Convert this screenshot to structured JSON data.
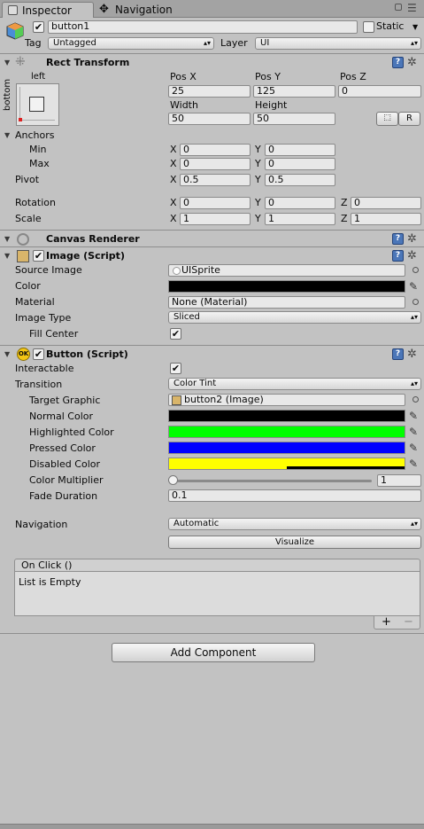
{
  "tabs": {
    "inspector": "Inspector",
    "navigation": "Navigation"
  },
  "object": {
    "name": "button1",
    "static_label": "Static",
    "tag_label": "Tag",
    "tag_value": "Untagged",
    "layer_label": "Layer",
    "layer_value": "UI"
  },
  "rect": {
    "title": "Rect Transform",
    "anchor_top": "left",
    "anchor_side": "bottom",
    "posx_label": "Pos X",
    "posy_label": "Pos Y",
    "posz_label": "Pos Z",
    "posx": "25",
    "posy": "125",
    "posz": "0",
    "width_label": "Width",
    "height_label": "Height",
    "width": "50",
    "height": "50",
    "raw_btn": "R",
    "anchors_label": "Anchors",
    "min_label": "Min",
    "max_label": "Max",
    "min_x": "0",
    "min_y": "0",
    "max_x": "0",
    "max_y": "0",
    "pivot_label": "Pivot",
    "pivot_x": "0.5",
    "pivot_y": "0.5",
    "rotation_label": "Rotation",
    "rot_x": "0",
    "rot_y": "0",
    "rot_z": "0",
    "scale_label": "Scale",
    "scale_x": "1",
    "scale_y": "1",
    "scale_z": "1",
    "x": "X",
    "y": "Y",
    "z": "Z"
  },
  "canvas_renderer": {
    "title": "Canvas Renderer"
  },
  "image": {
    "title": "Image (Script)",
    "source_label": "Source Image",
    "source_value": "UISprite",
    "color_label": "Color",
    "color": "#000000",
    "material_label": "Material",
    "material_value": "None (Material)",
    "type_label": "Image Type",
    "type_value": "Sliced",
    "fill_label": "Fill Center"
  },
  "button": {
    "title": "Button (Script)",
    "interactable_label": "Interactable",
    "transition_label": "Transition",
    "transition_value": "Color Tint",
    "target_label": "Target Graphic",
    "target_value": "button2 (Image)",
    "normal_label": "Normal Color",
    "normal_color": "#000000",
    "highlighted_label": "Highlighted Color",
    "highlighted_color": "#00ff00",
    "pressed_label": "Pressed Color",
    "pressed_color": "#0000ff",
    "disabled_label": "Disabled Color",
    "disabled_color": "#ffff00",
    "multiplier_label": "Color Multiplier",
    "multiplier_value": "1",
    "fade_label": "Fade Duration",
    "fade_value": "0.1",
    "navigation_label": "Navigation",
    "navigation_value": "Automatic",
    "visualize_label": "Visualize",
    "onclick_label": "On Click ()",
    "list_empty": "List is Empty",
    "plus": "+",
    "minus": "−"
  },
  "add_component": "Add Component",
  "icons": {
    "help": "help-icon",
    "gear": "gear-icon",
    "menu": "menu-icon",
    "lock": "lock-icon"
  }
}
